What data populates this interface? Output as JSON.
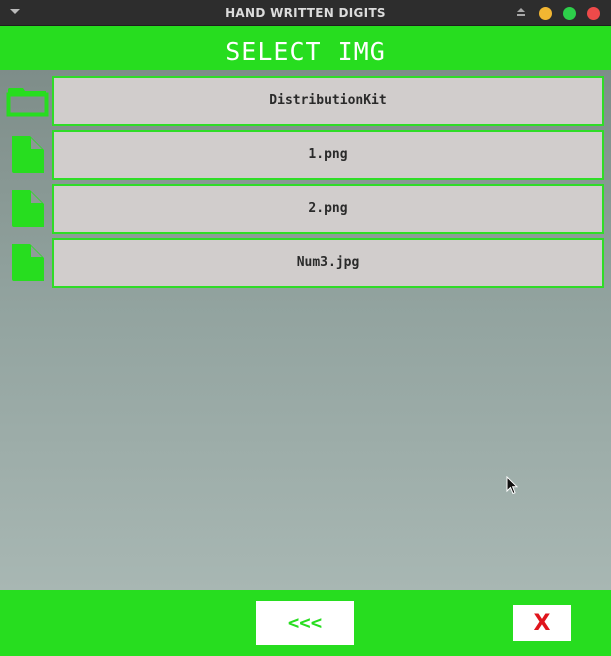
{
  "window": {
    "title": "HAND WRITTEN DIGITS"
  },
  "header": {
    "title": "SELECT IMG"
  },
  "files": [
    {
      "name": "DistributionKit",
      "type": "folder",
      "icon": "folder-icon"
    },
    {
      "name": "1.png",
      "type": "file",
      "icon": "file-icon"
    },
    {
      "name": "2.png",
      "type": "file",
      "icon": "file-icon"
    },
    {
      "name": "Num3.jpg",
      "type": "file",
      "icon": "file-icon"
    }
  ],
  "footer": {
    "back_label": "<<<",
    "close_label": "X"
  },
  "colors": {
    "accent": "#27dd1f",
    "item_bg": "#d1cdcc",
    "close_red": "#e0151d",
    "titlebar": "#2d2d2d"
  }
}
